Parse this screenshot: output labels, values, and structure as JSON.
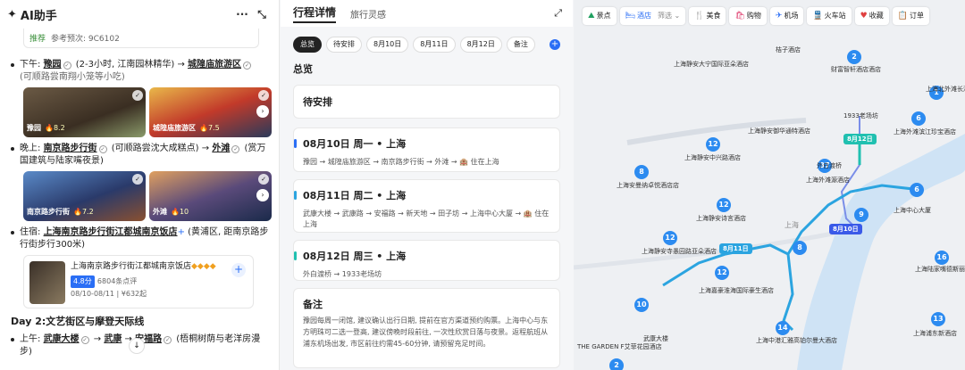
{
  "left": {
    "title": "AI助手",
    "ref": {
      "rec": "推荐",
      "text": "参考预次: 9C6102"
    },
    "afternoon": {
      "label": "下午:",
      "place": "豫园",
      "note": "(2-3小时, 江南园林精华)",
      "arrow": "→",
      "place2": "城隍庙旅游区",
      "sub": "(可顺路尝南翔小笼等小吃)"
    },
    "imgs1": [
      {
        "name": "豫园",
        "rating": "8.2"
      },
      {
        "name": "城隍庙旅游区",
        "rating": "7.5"
      }
    ],
    "evening": {
      "label": "晚上:",
      "place": "南京路步行街",
      "note": "(可顺路尝沈大成糕点)",
      "arrow": "→",
      "place2": "外滩",
      "sub": "(赏万国建筑与陆家嘴夜景)"
    },
    "imgs2": [
      {
        "name": "南京路步行街",
        "rating": "7.2"
      },
      {
        "name": "外滩",
        "rating": "10"
      }
    ],
    "stay": {
      "label": "住宿:",
      "place": "上海南京路步行街江都城南京饭店",
      "sub": "(黄浦区, 距南京路步行街步行300米)"
    },
    "hotel": {
      "name": "上海南京路步行街江都城南京饭店",
      "stars": "◆◆◆◆",
      "score": "4.8分",
      "reviews": "6804条点评",
      "date": "08/10-08/11",
      "price": "¥632起"
    },
    "day2": "Day 2:文艺街区与摩登天际线",
    "morning": {
      "label": "上午:",
      "place": "武康大楼",
      "arrow": "→",
      "place2": "武康",
      "arrow2": "→",
      "place3": "安福路",
      "sub": "(梧桐树荫与老洋房漫步)"
    }
  },
  "mid": {
    "tab1": "行程详情",
    "tab2": "旅行灵感",
    "chips": [
      "总览",
      "待安排",
      "8月10日",
      "8月11日",
      "8月12日",
      "备注"
    ],
    "overview": "总览",
    "pending": "待安排",
    "days": [
      {
        "title": "08月10日 周一 • 上海",
        "route": "豫园 → 城隍庙旅游区 → 南京路步行街 → 外滩 → 🏨 住在上海"
      },
      {
        "title": "08月11日 周二 • 上海",
        "route": "武康大楼 → 武康路 → 安福路 → 新天地 → 田子坊 → 上海中心大厦 → 🏨 住在上海"
      },
      {
        "title": "08月12日 周三 • 上海",
        "route": "外白渡桥 → 1933老场坊"
      }
    ],
    "notes_title": "备注",
    "notes": "豫园每周一闭馆, 建议确认出行日期, 提前在官方渠道预约购票。上海中心与东方明珠可二选一登高, 建议傍晚时段前往, 一次性欣赏日落与夜景。返程航班从浦东机场出发, 市区前往约需45-60分钟, 请预留充足时间。"
  },
  "map": {
    "tools": [
      {
        "icon": "⛰",
        "label": "景点"
      },
      {
        "icon": "🛏",
        "label": "酒店",
        "extra": "筛选 ⌄"
      },
      {
        "icon": "🍴",
        "label": "美食"
      },
      {
        "icon": "🛍",
        "label": "购物"
      },
      {
        "icon": "✈",
        "label": "机场"
      },
      {
        "icon": "🚆",
        "label": "火车站"
      },
      {
        "icon": "♥",
        "label": "收藏"
      },
      {
        "icon": "📋",
        "label": "订单"
      }
    ],
    "markers": [
      "2",
      "6",
      "6",
      "1",
      "12",
      "8",
      "12",
      "12",
      "12",
      "37",
      "9",
      "8",
      "10",
      "14",
      "16",
      "13",
      "2"
    ],
    "labels": [
      "上海静安大宁国际亚朵酒店",
      "桔子酒店",
      "财富智轩酒店酒店",
      "1933老场坊",
      "上海北外滩长酒店",
      "上海外滩滨江珍宝酒店",
      "上海静安中兴路酒店",
      "上海静安御华通特酒店",
      "上海安曼纳卓悦酒店店",
      "外白渡桥",
      "上海外滩源酒店",
      "上海中心大厦",
      "上海静安诗言酒店",
      "上海静安寺愚园路亚朵酒店",
      "上海嘉豪淮海国际豪生酒店",
      "上海中港汇雅高铂尔曼大酒店",
      "上海陆家嘴德斯丽酒店",
      "上海浦东新酒店",
      "武康大楼",
      "THE GARDEN F艾菲花园酒店",
      "上海"
    ],
    "days": [
      "8月12日",
      "8月10日",
      "8月11日"
    ]
  }
}
